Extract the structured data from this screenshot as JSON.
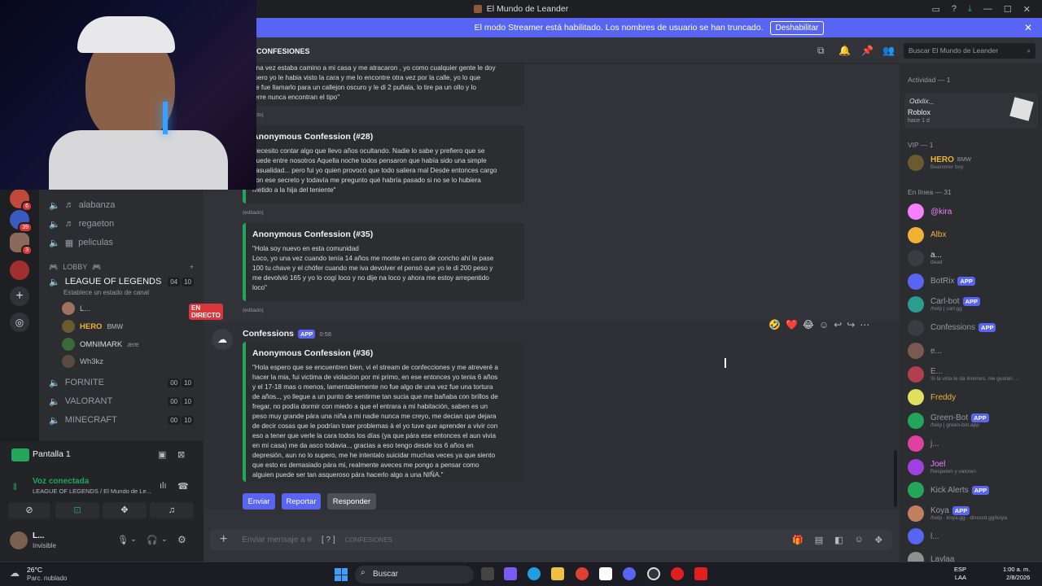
{
  "window": {
    "title": "El Mundo de Leander"
  },
  "streamer": {
    "message": "El modo Streamer está habilitado. Los nombres de usuario se han truncado.",
    "button": "Deshabilitar"
  },
  "servers": {
    "badges": [
      "6",
      "39",
      "3"
    ]
  },
  "channels": {
    "voice_music": [
      {
        "label": "alabanza"
      },
      {
        "label": "regaeton"
      },
      {
        "label": "peliculas"
      }
    ],
    "category": "LOBBY",
    "lol": {
      "name": "LEAGUE OF LEGENDS",
      "count_a": "04",
      "count_b": "10",
      "status_hint": "Establece un estado de canal"
    },
    "voice_users": [
      {
        "name": "L...",
        "live": "EN DIRECTO"
      },
      {
        "name": "HERO",
        "tag": "BMW"
      },
      {
        "name": "OMNIMARK",
        "tag": "ɹɐɾɐ"
      },
      {
        "name": "Wh3kz"
      }
    ],
    "others": [
      {
        "name": "FORNITE",
        "a": "00",
        "b": "10"
      },
      {
        "name": "VALORANT",
        "a": "00",
        "b": "10"
      },
      {
        "name": "MINECRAFT",
        "a": "00",
        "b": "10"
      }
    ]
  },
  "screen_share": {
    "label": "Pantalla 1"
  },
  "voice": {
    "status": "Voz conectada",
    "channel": "LEAGUE OF LEGENDS / El Mundo de Le..."
  },
  "user": {
    "name": "L...",
    "status": "Invisible"
  },
  "header": {
    "channel": "CONFESIONES",
    "search_placeholder": "Buscar El Mundo de Leander"
  },
  "messages": {
    "partial_top": "una vez estaba camino a mi casa y me atracaron , yo como cualquier gente le doy\n pero yo le habia visto la cara y me lo encontre otra vez por la calle, yo lo que\nce fue llamarlo para un callejon oscuro y le di 2 puñala, lo tire pa un ollo y lo\nterre nunca encontran el tipo\"",
    "edited": "(editado)",
    "c28": {
      "title": "Anonymous Confession (#28)",
      "body": "Necesito contar algo que llevo años ocultando. Nadie lo sabe y prefiero que se\nquede entre nosotros Aquella noche todos pensaron que había sido una simple\ncasualidad... pero fui yo quien provocó que todo saliera mal Desde entonces cargo\ncon ese secreto y todavía me pregunto qué habría pasado si no se lo hubiera\nmetido a la hija del teniente\""
    },
    "c35": {
      "title": "Anonymous Confession (#35)",
      "body": "\"Hola soy nuevo en esta comunidad\nLoco, yo una vez cuando tenía 14 años me monte en carro de concho ahí le pase\n100 tu chave y el chófer cuando me iva devolver el pensó que yo le di 200 peso y\nme devolvió 165 y yo lo cogí loco y no dije na loco y ahora me estoy arrepentido\nloco\""
    },
    "author": {
      "name": "Confessions",
      "badge": "APP",
      "time": "0:58"
    },
    "c36": {
      "title": "Anonymous Confession (#36)",
      "body": "\"Hola espero que se encuentren bien, vi el stream de confecciones y me atreveré a\nhacer la mia, fui victima de violacion por mi primo, en ese entonces yo tenia 6 años\ny el 17-18 mas o menos, lamentablemente no fue algo de una vez fue una tortura\nde años.., yo llegue a un punto de sentirme tan sucia que me bañaba con brillos de\nfregar, no podía dormir con miedo a que el entrara a mi habitación, saben es un\npeso muy grande pára una niña a mi nadie nunca me creyo, me decian que dejara\nde decir cosas que le podrían traer problemas à el yo tuve que aprender a vivir con\neso a tener que verle la cara todos los días (ya que pára ese entonces el aun vivia\nen mi casa) me da asco todavia.., gracias a eso tengo desde los 6 años en\ndepresión, aun no lo supero, me he intentalo suicidar muchas veces ya que siento\nque esto es demasiado pára mi, realmente aveces me pongo a pensar como\nalguien puede ser tan asqueroso pára hacerlo algo a una NIÑA.\""
    },
    "buttons": {
      "send": "Enviar",
      "report": "Reportar",
      "reply": "Responder"
    }
  },
  "composer": {
    "placeholder": "Enviar mensaje a #",
    "channel": "CONFESIONES"
  },
  "members": {
    "activity_header": "Actividad — 1",
    "activity": {
      "user": "Odxlix._",
      "game": "Roblox",
      "time": "hace 1 d"
    },
    "vip_header": "VIP — 1",
    "vip": [
      {
        "name": "HERO",
        "tag": "BMW",
        "sub": "Beammer boy"
      }
    ],
    "online_header": "En línea — 31",
    "online": [
      {
        "name": "@kira",
        "sub": "",
        "color": "#f47fff"
      },
      {
        "name": "Albx",
        "sub": "",
        "color": "#f0b232"
      },
      {
        "name": "a...",
        "sub": "dead",
        "color": "#dbdee1"
      },
      {
        "name": "BotRix",
        "sub": "",
        "app": "APP",
        "color": "#949ba4"
      },
      {
        "name": "Carl-bot",
        "sub": "/help | carl.gg",
        "app": "APP",
        "color": "#949ba4"
      },
      {
        "name": "Confessions",
        "sub": "",
        "app": "APP",
        "color": "#949ba4"
      },
      {
        "name": "e...",
        "sub": "",
        "color": "#949ba4"
      },
      {
        "name": "E...",
        "sub": "Si la vida te da limones, me gustan ...",
        "color": "#949ba4"
      },
      {
        "name": "Freddy",
        "sub": "",
        "color": "#f0b232"
      },
      {
        "name": "Green-Bot",
        "sub": "/help | green-bot.app",
        "app": "APP",
        "color": "#949ba4"
      },
      {
        "name": "j...",
        "sub": "",
        "color": "#949ba4"
      },
      {
        "name": "Joel",
        "sub": "Respeten y valoren",
        "color": "#f47fff"
      },
      {
        "name": "Kick Alerts",
        "sub": "",
        "app": "APP",
        "color": "#949ba4"
      },
      {
        "name": "Koya",
        "sub": "/help · koya.gg · discord.gg/koya",
        "app": "APP",
        "color": "#949ba4"
      },
      {
        "name": "l...",
        "sub": "",
        "color": "#949ba4"
      },
      {
        "name": "Laylaa",
        "sub": "",
        "color": "#949ba4"
      }
    ]
  },
  "taskbar": {
    "temp": "26°C",
    "weather": "Parc. nublado",
    "search": "Buscar",
    "lang": "ESP",
    "lang2": "LAA",
    "time": "1:00 a. m.",
    "date": "2/8/2026"
  }
}
